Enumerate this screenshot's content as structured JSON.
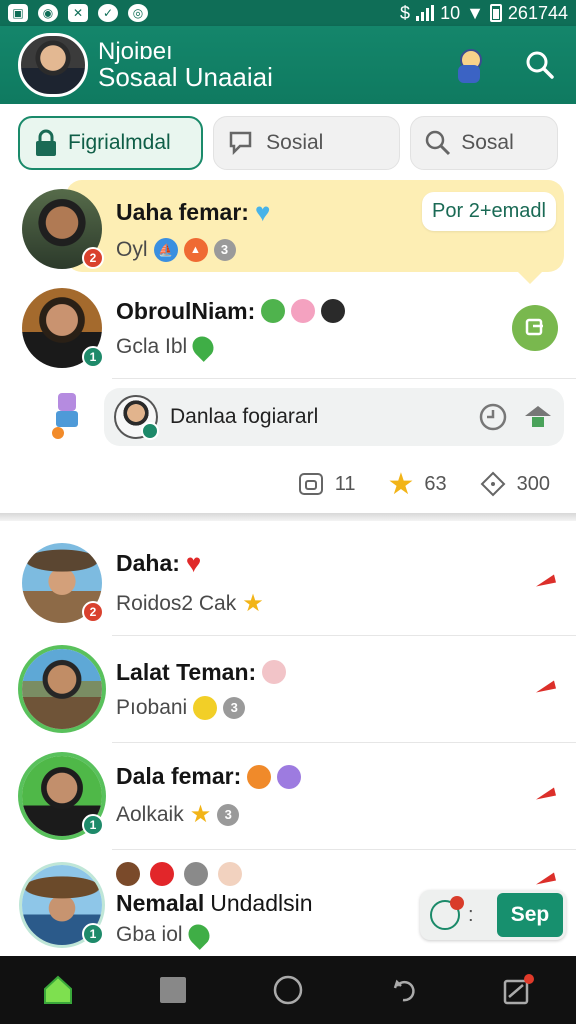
{
  "status_bar": {
    "time": "261744",
    "right_text": "10"
  },
  "header": {
    "title_line1": "Njoiɒeı",
    "title_line2": "Sosaal Unaaiai",
    "search_label": "search"
  },
  "filters": [
    {
      "label": "Figrialmdal",
      "icon": "lock-icon",
      "active": true
    },
    {
      "label": "Sosial",
      "icon": "chat-icon",
      "active": false
    },
    {
      "label": "Sosal",
      "icon": "search-icon",
      "active": false
    }
  ],
  "feed": {
    "highlighted": {
      "name": "Uaha femar:",
      "sub": "Oyl",
      "badge": "2",
      "count": "3",
      "action_label": "Por 2+emadl"
    },
    "item2": {
      "name": "ObroulNiam:",
      "sub": "Gcla Ibl",
      "badge": "1"
    },
    "composer": {
      "text": "Danlaa fogiararl"
    },
    "stats": [
      {
        "icon": "photo-icon",
        "value": "11"
      },
      {
        "icon": "star-icon",
        "value": "63"
      },
      {
        "icon": "diamond-icon",
        "value": "300"
      }
    ]
  },
  "friends": [
    {
      "name": "Daha:",
      "sub": "Roidos2 Cak",
      "badge": "2",
      "badge_color": "#d9412e"
    },
    {
      "name": "Lalat Teman:",
      "sub": "Pıobani",
      "badge": "",
      "count": "3"
    },
    {
      "name": "Dala femar:",
      "sub": "Aolkaik",
      "badge": "1",
      "count": "3"
    },
    {
      "name_bold": "Nemalal",
      "name_plain": "Undadlsin",
      "sub": "Gba iol",
      "badge": "1"
    }
  ],
  "floating_button": {
    "label": "Sep",
    "separator": ":"
  },
  "colors": {
    "primary": "#14866b",
    "accent_green": "#59c15c",
    "badge_red": "#d9412e",
    "highlight": "#fdeeb4"
  }
}
